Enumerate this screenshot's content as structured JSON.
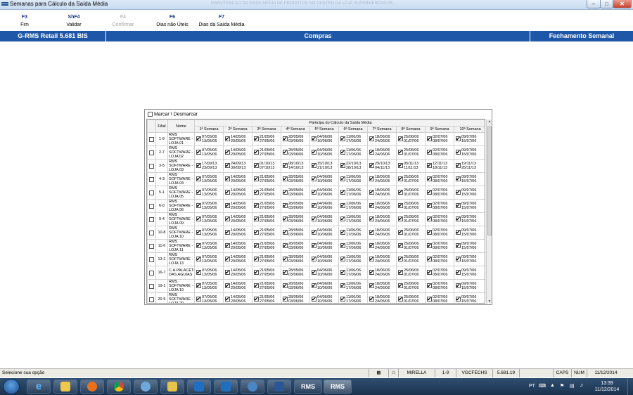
{
  "window": {
    "title": "Semanas para Cálculo da Saída Média",
    "faded_title": "MANUTENCAO DA SAIDA MEDIA DE PRODUTOS NO CENTRO DA LOJA SUPERMERCADOS"
  },
  "toolbar": [
    {
      "key": "F3",
      "label": "Fim",
      "enabled": true
    },
    {
      "key": "ShF4",
      "label": "Validar",
      "enabled": true
    },
    {
      "key": "F4",
      "label": "Confirmar",
      "enabled": false
    },
    {
      "key": "F6",
      "label": "Dias não Úteis",
      "enabled": true
    },
    {
      "key": "F7",
      "label": "Dias da Saída Média",
      "enabled": true
    }
  ],
  "header": {
    "left": "G-RMS Retail 5.681 BIS",
    "center": "Compras",
    "right": "Fechamento Semanal"
  },
  "dialog": {
    "marcar_label": "Marcar \\ Desmarcar",
    "group_header": "Participa do Cálculo da Saída Média",
    "col_filial": "Filial",
    "col_nome": "Nome",
    "week_headers": [
      "1ª Semana",
      "2ª Semana",
      "3ª Semana",
      "4ª Semana",
      "5ª Semana",
      "6ª Semana",
      "7ª Semana",
      "8ª Semana",
      "9ª Semana",
      "10ª Semana"
    ],
    "default_weeks": [
      [
        "07/05/06",
        "13/05/06"
      ],
      [
        "14/05/06",
        "20/05/06"
      ],
      [
        "21/05/06",
        "27/05/06"
      ],
      [
        "28/05/06",
        "03/06/06"
      ],
      [
        "04/06/06",
        "10/06/06"
      ],
      [
        "11/06/06",
        "17/06/06"
      ],
      [
        "18/06/06",
        "24/06/06"
      ],
      [
        "25/06/06",
        "01/07/06"
      ],
      [
        "02/07/06",
        "08/07/06"
      ],
      [
        "09/07/06",
        "15/07/06"
      ]
    ],
    "rows": [
      {
        "filial": "1-9",
        "name1": "RMS",
        "name2": "SOFTWARE -",
        "name3": "LOJA 01"
      },
      {
        "filial": "2-7",
        "name1": "RMS",
        "name2": "SOFTWARE -",
        "name3": "LOJA 02"
      },
      {
        "filial": "3-5",
        "name1": "RMS",
        "name2": "SOFTWARE -",
        "name3": "LOJA 03",
        "weeks": [
          [
            "17/09/13",
            "23/09/13"
          ],
          [
            "24/09/13",
            "30/09/13"
          ],
          [
            "01/10/13",
            "07/10/13"
          ],
          [
            "08/10/13",
            "14/10/13"
          ],
          [
            "15/10/13",
            "21/10/13"
          ],
          [
            "22/10/13",
            "28/10/13"
          ],
          [
            "29/10/13",
            "04/11/13"
          ],
          [
            "05/11/13",
            "11/11/13"
          ],
          [
            "12/11/13",
            "18/11/13"
          ],
          [
            "19/11/13",
            "25/11/13"
          ]
        ]
      },
      {
        "filial": "4-3",
        "name1": "RMS",
        "name2": "SOFTWARE -",
        "name3": "LOJA 04"
      },
      {
        "filial": "5-1",
        "name1": "RMS",
        "name2": "SOFTWARE -",
        "name3": "LOJA 05"
      },
      {
        "filial": "6-0",
        "name1": "RMS",
        "name2": "SOFTWARE -",
        "name3": "LOJA 06"
      },
      {
        "filial": "9-4",
        "name1": "RMS",
        "name2": "SOFTWARE -",
        "name3": "LOJA 09"
      },
      {
        "filial": "10-8",
        "name1": "RMS",
        "name2": "SOFTWARE -",
        "name3": "LOJA 10"
      },
      {
        "filial": "11-6",
        "name1": "RMS",
        "name2": "SOFTWARE -",
        "name3": "LOJA 11"
      },
      {
        "filial": "13-2",
        "name1": "RMS",
        "name2": "SOFTWARE -",
        "name3": "LOJA 13"
      },
      {
        "filial": "16-7",
        "name1": "C.A.PALACETE",
        "name2": "DAS AGUIAS",
        "name3": ""
      },
      {
        "filial": "19-1",
        "name1": "RMS",
        "name2": "SOFTWARE -",
        "name3": "LOJA 19"
      },
      {
        "filial": "20-5",
        "name1": "RMS",
        "name2": "SOFTWARE -",
        "name3": "LOJA 20"
      }
    ]
  },
  "statusbar": {
    "message": "Selecione sua opção",
    "user": "MIRELLA",
    "filial": "1-9",
    "program": "VGCFECHS",
    "version": "5.681.19",
    "caps": "CAPS",
    "num": "NUM",
    "date": "11/12/2014"
  },
  "taskbar": {
    "lang": "PT",
    "time": "13:39",
    "date": "11/12/2014",
    "rms_label": "RMS"
  },
  "colors": {
    "header_blue": "#1f57a8",
    "key_blue": "#1f3b8a",
    "taskbar": "#1b324e"
  }
}
